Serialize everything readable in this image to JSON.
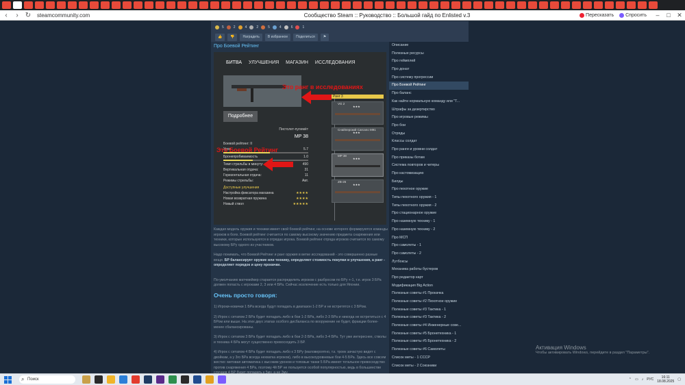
{
  "browser": {
    "tab_icon_colors": [
      "#e84a3a",
      "#ffffff",
      "#e84a3a",
      "#e84a3a",
      "#e84a3a",
      "#e84a3a",
      "#e84a3a",
      "#e84a3a",
      "#e84a3a",
      "#e84a3a",
      "#e84a3a",
      "#e84a3a",
      "#e84a3a",
      "#e84a3a",
      "#e84a3a",
      "#e84a3a",
      "#e84a3a",
      "#e84a3a",
      "#e84a3a",
      "#e84a3a",
      "#e84a3a",
      "#e84a3a",
      "#e84a3a",
      "#e84a3a",
      "#e84a3a",
      "#e84a3a",
      "#e84a3a",
      "#e84a3a",
      "#e84a3a",
      "#e84a3a",
      "#e84a3a",
      "#e84a3a",
      "#e84a3a",
      "#e84a3a",
      "#e84a3a",
      "#e84a3a",
      "#e84a3a",
      "#e84a3a",
      "#e84a3a",
      "#e84a3a",
      "#e84a3a",
      "#e84a3a",
      "#e84a3a",
      "#e84a3a",
      "#e84a3a",
      "#e84a3a",
      "#e84a3a",
      "#e84a3a",
      "#e84a3a",
      "#e84a3a",
      "#e84a3a",
      "#e84a3a",
      "#e84a3a",
      "#e84a3a",
      "#e84a3a",
      "#e84a3a",
      "#e84a3a",
      "#e84a3a",
      "#e84a3a",
      "#e84a3a"
    ],
    "url": "steamcommunity.com",
    "window_title": "Сообщество Steam :: Руководство :: Большой гайд по Enlisted v.3",
    "retell_label": "Пересказать",
    "ask_label": "Спросить"
  },
  "guide_toolbar": {
    "stats": [
      "5",
      "2",
      "4",
      "2",
      "5",
      "4",
      "6",
      "1"
    ],
    "award_label": "Наградить",
    "favorite_label": "В избранное",
    "share_label": "Поделиться"
  },
  "section_title": "Про Боевой Рейтинг",
  "game_screenshot": {
    "tabs": [
      "БИТВА",
      "УЛУЧШЕНИЯ",
      "МАГАЗИН",
      "ИССЛЕДОВАНИЯ"
    ],
    "detail_button": "Подробнее",
    "weapon_type": "Пистолет-пулемёт",
    "weapon_name": "MP 38",
    "battle_rating": "Боевой рейтинг: II",
    "stats": [
      {
        "label": "Урон",
        "value": "5.7",
        "fill": 0.55
      },
      {
        "label": "Бронепробиваемость",
        "value": "1.0",
        "fill": 0.35
      },
      {
        "label": "Темп стрельбы в минуту:",
        "value": "490"
      },
      {
        "label": "Вертикальная отдача:",
        "value": "31"
      },
      {
        "label": "Горизонтальная отдача:",
        "value": "11"
      },
      {
        "label": "Режимы стрельбы:",
        "value": "Авт."
      }
    ],
    "upgrades_title": "Доступные улучшения",
    "upgrades": [
      {
        "label": "Настройка фиксатора магазина",
        "stars": "★★★★"
      },
      {
        "label": "Новая возвратная пружина",
        "stars": "★★★★"
      },
      {
        "label": "Новый ствол",
        "stars": "★★★★★"
      }
    ],
    "annotation_rank": "Это ранг в исследованиях",
    "annotation_br": "Это Боевой Рейтинг",
    "rank_label": "Ранг 3",
    "tree_nodes": [
      {
        "name": "VG 2",
        "stars": "★★★"
      },
      {
        "name": "Снайперский Carcano M91",
        "stars": "★★★"
      },
      {
        "name": "MP 38",
        "stars": "★★★"
      },
      {
        "name": "ZB-26",
        "stars": "★★★"
      }
    ]
  },
  "article": {
    "p1": "Каждая модель оружия и техники имеет свой боевой рейтинг, на основе которого формируются команды игроков в боях. Боевой рейтинг считается по самому высокому значению предмета снаряжения или техники, которые используются в отрядах игрока. Боевой рейтинг отряда игроков считается по самому высокому БРу одного из участников.",
    "p2_start": "Надо понимать, что Боевой Рейтинг и ранг оружия в ветке исследований - это совершенно разные вещи. ",
    "p2_bold": "БР балансирует оружие или технику, определяет стоимость покупки и улучшения, а ранг - определяет порядок и цену прокачки.",
    "p3": "По-умолчанию матчмейкер старается распределить игроков с разбросом по БРу +-1, т.е. игрок 3 БРа должен попасть с игроками 2, 3 или 4 БРа. Сейчас исключение есть только для Японии.",
    "heading": "Очень просто говоря:",
    "l1": "1) Игроки-новички 1 БРа всегда будут попадать в диапазон 1-2 БР и не встретятся с 3 БРом.",
    "l2": "2) Игрок с сетапом 2 БРа будет попадать либо в бои 1-2 БРа, либо 2-3 БРа и никогда не встретиться с 4 БРом или выше. На этих двух этапах особого дисбаланса по вооружение не будет, фракции более-менее сбалансированы.",
    "l3": "3) Игрок с сетапом 3 БРа будет попадать либо в бои 2-3 БРа, либо 3-4 БРа. Тут уже интереснее, стволы и техника 4 БРа могут существенно превосходить 3 БР.",
    "l4": "4) Игрок с сетапом 4 БРа будет попадать либо к 3 БРу (маловероятно, т.к. троек зачастую видят с двойкам, а у 3го БРа всегда нехватка игроков), либо в высокоуровневые бои 4-5 БРа. Здесь все совсем жестко: метовая автоматика с высоким уроном и топовые танки 5 БРа имеют тотальное превосходство против снаряжения 4 БРа, поэтому 4й БР не пользуется особой популярностью, ведь в большинстве случаев 4 БР будет попадать к 5му, а не 3му."
  },
  "sidebar": {
    "items": [
      "Описание",
      "Полезные ресурсы",
      "Про геймплей",
      "Про донат",
      "Про систему прогрессии",
      "Про Боевой Рейтинг",
      "Про баланс",
      "Как найти нормальную команду или \"Т...",
      "Штрафы за дезертирство",
      "Про игровые режимы",
      "Про бои",
      "Отряды",
      "Классы солдат",
      "Про ранги и уровни солдат",
      "Про приказы ботам",
      "Система повторов и читеры",
      "Про кастомизацию",
      "Билды",
      "Про пехотное оружие",
      "Типы пехотного оружия - 1",
      "Типы пехотного оружия - 2",
      "Про стационарное оружие",
      "Про наземную технику - 1",
      "Про наземную технику - 2",
      "Про МСП",
      "Про самолеты - 1",
      "Про самолеты - 2",
      "Лутбоксы",
      "Механика работы бустеров",
      "Про редактор карт",
      "Модификация Big Action",
      "Полезные советы #1 Прокачка",
      "Полезные советы #2 Пехотное оружие",
      "Полезные советы #3 Тактика - 1",
      "Полезные советы #3 Тактика - 2",
      "Полезные советы #4 Инженерные сове...",
      "Полезные советы #5 Бронетехника - 1",
      "Полезные советы #5 Бронетехника - 2",
      "Полезные советы #6 Самолеты",
      "Список меты - 1 СССР",
      "Список меты - 2 Союзники"
    ],
    "active_index": 5
  },
  "activation": {
    "title": "Активация Windows",
    "subtitle": "Чтобы активировать Windows, перейдите в раздел \"Параметры\"."
  },
  "taskbar": {
    "search_placeholder": "Поиск",
    "lang": "РУС",
    "time": "16:11",
    "date": "18.08.2025"
  }
}
